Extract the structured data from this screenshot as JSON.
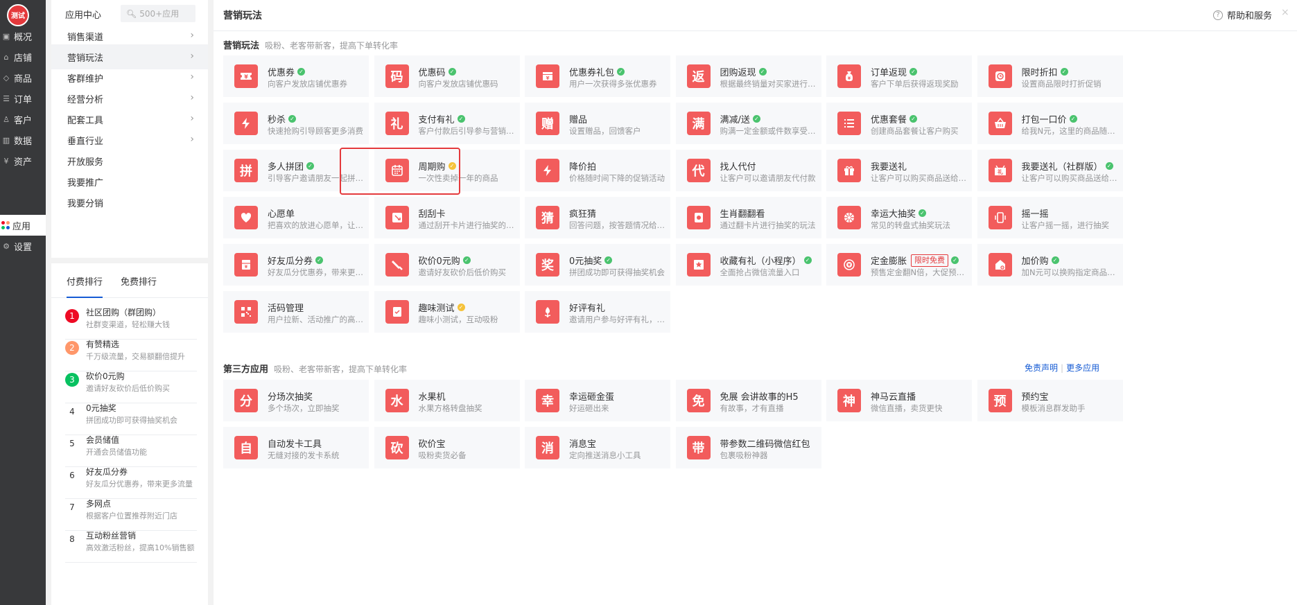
{
  "app": {
    "logo_text": "测试"
  },
  "rail": {
    "items": [
      {
        "label": "概况",
        "icon": "overview-icon",
        "glyph": "▣"
      },
      {
        "label": "店铺",
        "icon": "store-icon",
        "glyph": "⌂"
      },
      {
        "label": "商品",
        "icon": "tag-icon",
        "glyph": "◇"
      },
      {
        "label": "订单",
        "icon": "order-icon",
        "glyph": "☰"
      },
      {
        "label": "客户",
        "icon": "user-icon",
        "glyph": "♙"
      },
      {
        "label": "数据",
        "icon": "chart-icon",
        "glyph": "▥"
      },
      {
        "label": "资产",
        "icon": "yen-icon",
        "glyph": "¥"
      }
    ],
    "apps_label": "应用",
    "settings": {
      "label": "设置",
      "glyph": "⚙"
    }
  },
  "subnav": {
    "title": "应用中心",
    "search_placeholder": "500+应用",
    "items": [
      "销售渠道",
      "营销玩法",
      "客群维护",
      "经营分析",
      "配套工具",
      "垂直行业",
      "开放服务",
      "我要推广",
      "我要分销"
    ],
    "chevron": "›"
  },
  "rank": {
    "tabs": [
      "付费排行",
      "免费排行"
    ],
    "items": [
      {
        "num": "1",
        "name": "社区团购（群团购）",
        "desc": "社群变渠道，轻松赚大钱",
        "color": "#ee0a24"
      },
      {
        "num": "2",
        "name": "有赞精选",
        "desc": "千万级流量，交易额翻倍提升",
        "color": "#ff976a"
      },
      {
        "num": "3",
        "name": "砍价0元购",
        "desc": "邀请好友砍价后低价购买",
        "color": "#07c160"
      },
      {
        "num": "4",
        "name": "0元抽奖",
        "desc": "拼团成功即可获得抽奖机会",
        "color": ""
      },
      {
        "num": "5",
        "name": "会员储值",
        "desc": "开通会员储值功能",
        "color": ""
      },
      {
        "num": "6",
        "name": "好友瓜分券",
        "desc": "好友瓜分优惠券，带来更多流量",
        "color": ""
      },
      {
        "num": "7",
        "name": "多网点",
        "desc": "根据客户位置推荐附近门店",
        "color": ""
      },
      {
        "num": "8",
        "name": "互动粉丝营销",
        "desc": "高效激活粉丝，提高10%销售额",
        "color": ""
      }
    ]
  },
  "main": {
    "title": "营销玩法",
    "help": "帮助和服务",
    "close": "×",
    "section1": {
      "title": "营销玩法",
      "sub": "吸粉、老客带新客，提高下单转化率"
    },
    "section2": {
      "title": "第三方应用",
      "sub": "吸粉、老客带新客，提高下单转化率",
      "links": [
        "免责声明",
        "更多应用"
      ]
    },
    "check_mark": "✓",
    "badge_text": "限时免费",
    "cards": [
      {
        "title": "优惠券",
        "desc": "向客户发放店铺优惠券",
        "icon": "coupon-icon",
        "check": "g"
      },
      {
        "title": "优惠码",
        "desc": "向客户发放店铺优惠码",
        "icon": "code-icon",
        "glyph": "码",
        "check": "g"
      },
      {
        "title": "优惠券礼包",
        "desc": "用户一次获得多张优惠券",
        "icon": "coupon-pack-icon",
        "check": "g"
      },
      {
        "title": "团购返现",
        "desc": "根据最终销量对买家进行返现",
        "icon": "rebate-icon",
        "glyph": "返",
        "check": "g"
      },
      {
        "title": "订单返现",
        "desc": "客户下单后获得返现奖励",
        "icon": "money-bag-icon",
        "check": "g"
      },
      {
        "title": "限时折扣",
        "desc": "设置商品限时打折促销",
        "icon": "clock-icon",
        "check": "g"
      },
      {
        "title": "秒杀",
        "desc": "快速抢购引导顾客更多消费",
        "icon": "lightning-icon",
        "check": "g"
      },
      {
        "title": "支付有礼",
        "desc": "客户付款后引导参与营销互动",
        "icon": "gift-text-icon",
        "glyph": "礼",
        "check": "g"
      },
      {
        "title": "赠品",
        "desc": "设置赠品，回馈客户",
        "icon": "gift-text-icon",
        "glyph": "赠",
        "check": ""
      },
      {
        "title": "满减/送",
        "desc": "购满一定金额或件数享受优惠",
        "icon": "full-reduction-icon",
        "glyph": "满",
        "check": "g"
      },
      {
        "title": "优惠套餐",
        "desc": "创建商品套餐让客户购买",
        "icon": "list-icon",
        "check": "g"
      },
      {
        "title": "打包一口价",
        "desc": "给我N元，这里的商品随便挑",
        "icon": "basket-icon",
        "check": "g"
      },
      {
        "title": "多人拼团",
        "desc": "引导客户邀请朋友一起拼团购买",
        "icon": "group-buy-icon",
        "glyph": "拼",
        "check": "g"
      },
      {
        "title": "周期购",
        "desc": "一次性卖掉一年的商品",
        "icon": "calendar-icon",
        "check": "y"
      },
      {
        "title": "降价拍",
        "desc": "价格随时间下降的促销活动",
        "icon": "lightning-icon",
        "check": ""
      },
      {
        "title": "找人代付",
        "desc": "让客户可以邀请朋友代付款",
        "icon": "proxy-pay-icon",
        "glyph": "代",
        "check": ""
      },
      {
        "title": "我要送礼",
        "desc": "让客户可以购买商品送给朋友",
        "icon": "gift-box-icon",
        "check": ""
      },
      {
        "title": "我要送礼（社群版）",
        "desc": "让客户可以购买商品送给朋友",
        "icon": "community-gift-icon",
        "check": "g"
      },
      {
        "title": "心愿单",
        "desc": "把喜欢的放进心愿单，让朋友...",
        "icon": "heart-icon",
        "check": ""
      },
      {
        "title": "刮刮卡",
        "desc": "通过刮开卡片进行抽奖的玩法",
        "icon": "scratch-card-icon",
        "check": ""
      },
      {
        "title": "疯狂猜",
        "desc": "回答问题，按答题情况给奖励",
        "icon": "guess-icon",
        "glyph": "猜",
        "check": ""
      },
      {
        "title": "生肖翻翻看",
        "desc": "通过翻卡片进行抽奖的玩法",
        "icon": "flip-card-icon",
        "check": ""
      },
      {
        "title": "幸运大抽奖",
        "desc": "常见的转盘式抽奖玩法",
        "icon": "wheel-icon",
        "check": "g"
      },
      {
        "title": "摇一摇",
        "desc": "让客户摇一摇，进行抽奖",
        "icon": "phone-shake-icon",
        "check": ""
      },
      {
        "title": "好友瓜分券",
        "desc": "好友瓜分优惠券，带来更多流量",
        "icon": "split-coupon-icon",
        "check": "g"
      },
      {
        "title": "砍价0元购",
        "desc": "邀请好友砍价后低价购买",
        "icon": "knife-icon",
        "check": "g"
      },
      {
        "title": "0元抽奖",
        "desc": "拼团成功即可获得抽奖机会",
        "icon": "prize-icon",
        "glyph": "奖",
        "check": "g"
      },
      {
        "title": "收藏有礼（小程序）",
        "desc": "全面抢占微信流量入口",
        "icon": "star-icon",
        "check": "g"
      },
      {
        "title": "定金膨胀",
        "desc": "预售定金翻N倍，大促预热利器",
        "icon": "deposit-icon",
        "check": "g",
        "badge": true
      },
      {
        "title": "加价购",
        "desc": "加N元可以换购指定商品，提...",
        "icon": "add-price-icon",
        "check": "g"
      },
      {
        "title": "活码管理",
        "desc": "用户拉新、活动推广的高效引...",
        "icon": "qrcode-icon",
        "check": ""
      },
      {
        "title": "趣味测试",
        "desc": "趣味小测试，互动吸粉",
        "icon": "quiz-icon",
        "check": "y"
      },
      {
        "title": "好评有礼",
        "desc": "邀请用户参与好评有礼，沉淀...",
        "icon": "flower-icon",
        "check": ""
      }
    ],
    "third_party": [
      {
        "title": "分场次抽奖",
        "desc": "多个场次，立即抽奖",
        "glyph": "分"
      },
      {
        "title": "水果机",
        "desc": "水果方格转盘抽奖",
        "glyph": "水"
      },
      {
        "title": "幸运砸金蛋",
        "desc": "好运砸出来",
        "glyph": "幸"
      },
      {
        "title": "免展 会讲故事的H5",
        "desc": "有故事，才有直播",
        "glyph": "免"
      },
      {
        "title": "神马云直播",
        "desc": "微信直播，卖货更快",
        "glyph": "神"
      },
      {
        "title": "预约宝",
        "desc": "模板消息群发助手",
        "glyph": "预"
      },
      {
        "title": "自动发卡工具",
        "desc": "无缝对接的发卡系统",
        "glyph": "自"
      },
      {
        "title": "砍价宝",
        "desc": "吸粉卖货必备",
        "glyph": "砍"
      },
      {
        "title": "消息宝",
        "desc": "定向推送消息小工具",
        "glyph": "消"
      },
      {
        "title": "带参数二维码微信红包",
        "desc": "包裹吸粉神器",
        "glyph": "带"
      }
    ]
  },
  "colors": {
    "accent_red": "#f25c5c",
    "link_blue": "#155bd4",
    "check_green": "#4ac36e",
    "check_yellow": "#f5c23a"
  }
}
